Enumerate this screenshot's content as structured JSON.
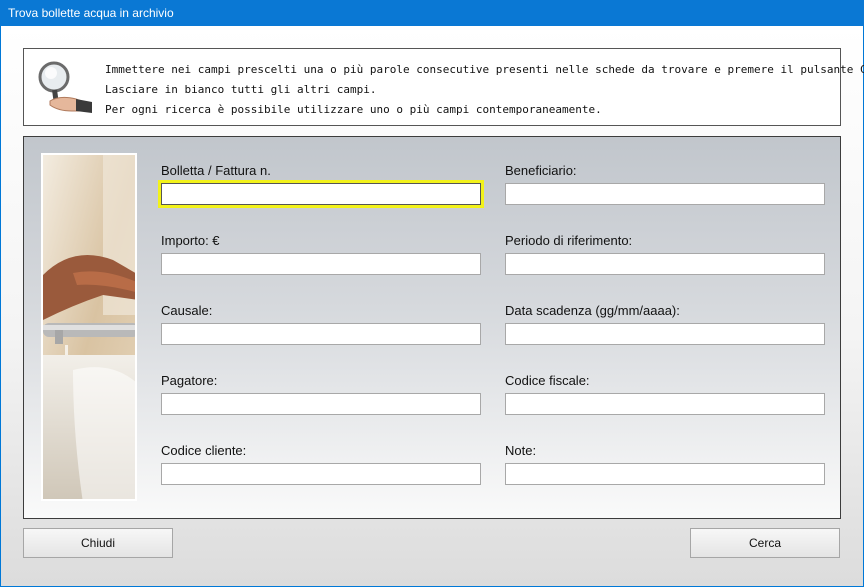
{
  "window": {
    "title": "Trova bollette acqua in archivio"
  },
  "info": {
    "lines": [
      "Immettere nei campi prescelti una o più parole consecutive presenti nelle schede da trovare e premere il pulsante Cerca.",
      "Lasciare in bianco tutti gli altri campi.",
      "Per ogni ricerca è possibile utilizzare uno o più campi contemporaneamente."
    ],
    "icon": "magnifier-in-hand-icon"
  },
  "form": {
    "fields": [
      {
        "label": "Bolletta / Fattura n.",
        "value": "",
        "focused": true
      },
      {
        "label": "Beneficiario:",
        "value": ""
      },
      {
        "label": "Importo: €",
        "value": ""
      },
      {
        "label": "Periodo di riferimento:",
        "value": ""
      },
      {
        "label": "Causale:",
        "value": ""
      },
      {
        "label": "Data scadenza (gg/mm/aaaa):",
        "value": ""
      },
      {
        "label": "Pagatore:",
        "value": ""
      },
      {
        "label": "Codice fiscale:",
        "value": ""
      },
      {
        "label": "Codice cliente:",
        "value": ""
      },
      {
        "label": "Note:",
        "value": ""
      }
    ],
    "focus_color": "#f2f21a"
  },
  "buttons": {
    "close_label": "Chiudi",
    "search_label": "Cerca"
  }
}
